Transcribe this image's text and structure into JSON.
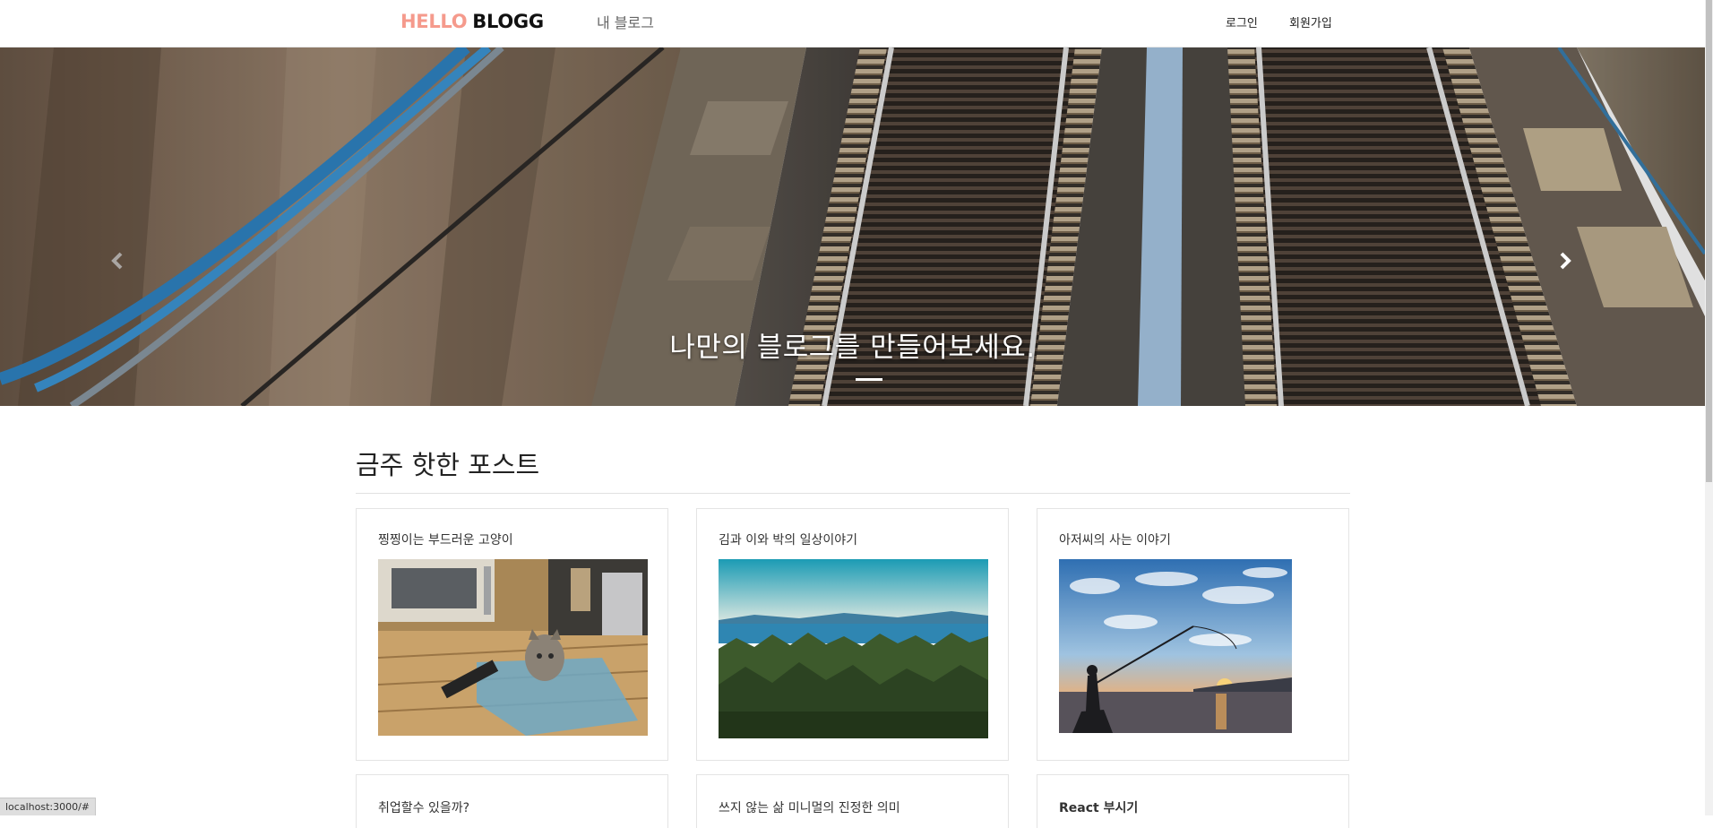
{
  "navbar": {
    "brand_part1": "HELLO",
    "brand_part2": "BLOGG",
    "my_blog": "내 블로그",
    "login": "로그인",
    "signup": "회원가입"
  },
  "hero": {
    "caption": "나만의 블로그를 만들어보세요.",
    "prev_icon": "chevron-left-icon",
    "next_icon": "chevron-right-icon"
  },
  "main": {
    "section_title": "금주 핫한 포스트",
    "posts": [
      {
        "title": "찡찡이는 부드러운 고양이"
      },
      {
        "title": "김과 이와 박의 일상이야기"
      },
      {
        "title": "아저씨의 사는 이야기"
      },
      {
        "title": "취업할수 있을까?"
      },
      {
        "title": "쓰지 않는 삶 미니멀의 진정한 의미"
      },
      {
        "title": "React 부시기"
      }
    ]
  },
  "status": {
    "url": "localhost:3000/#"
  },
  "colors": {
    "brand_accent": "#f59a8c",
    "brand_dark": "#111111"
  }
}
